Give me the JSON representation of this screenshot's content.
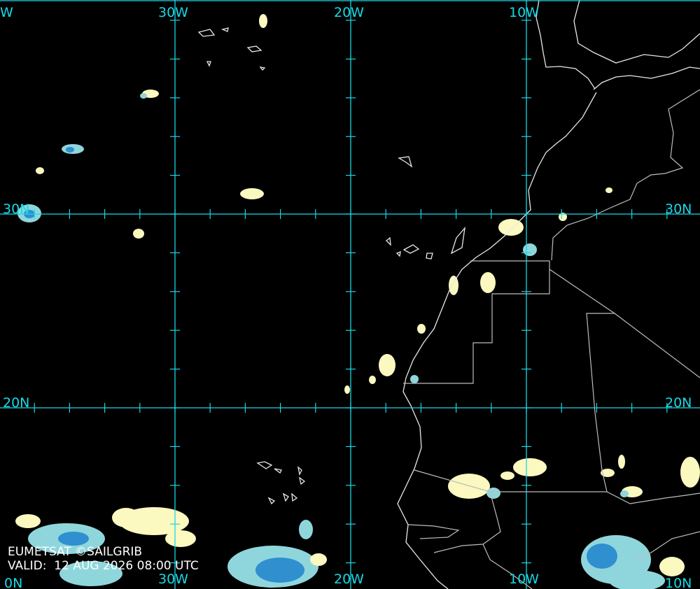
{
  "map": {
    "colors": {
      "grid": "#19d8e6",
      "coast": "#e8e8e8",
      "border": "#bdbdbd",
      "cloud_light": "#fbf8c0",
      "cloud_mid": "#8fd6dc",
      "cloud_deep": "#2f8fcf"
    },
    "lon_labels": [
      "30W",
      "20W",
      "10W"
    ],
    "lat_labels": [
      "30N",
      "20N",
      "10N"
    ],
    "edge_labels": {
      "top_left": "W",
      "bottom_left": "0N"
    },
    "credit": "EUMETSAT ©SAILGRIB",
    "valid": "VALID:  12 AUG 2026 08:00 UTC"
  }
}
